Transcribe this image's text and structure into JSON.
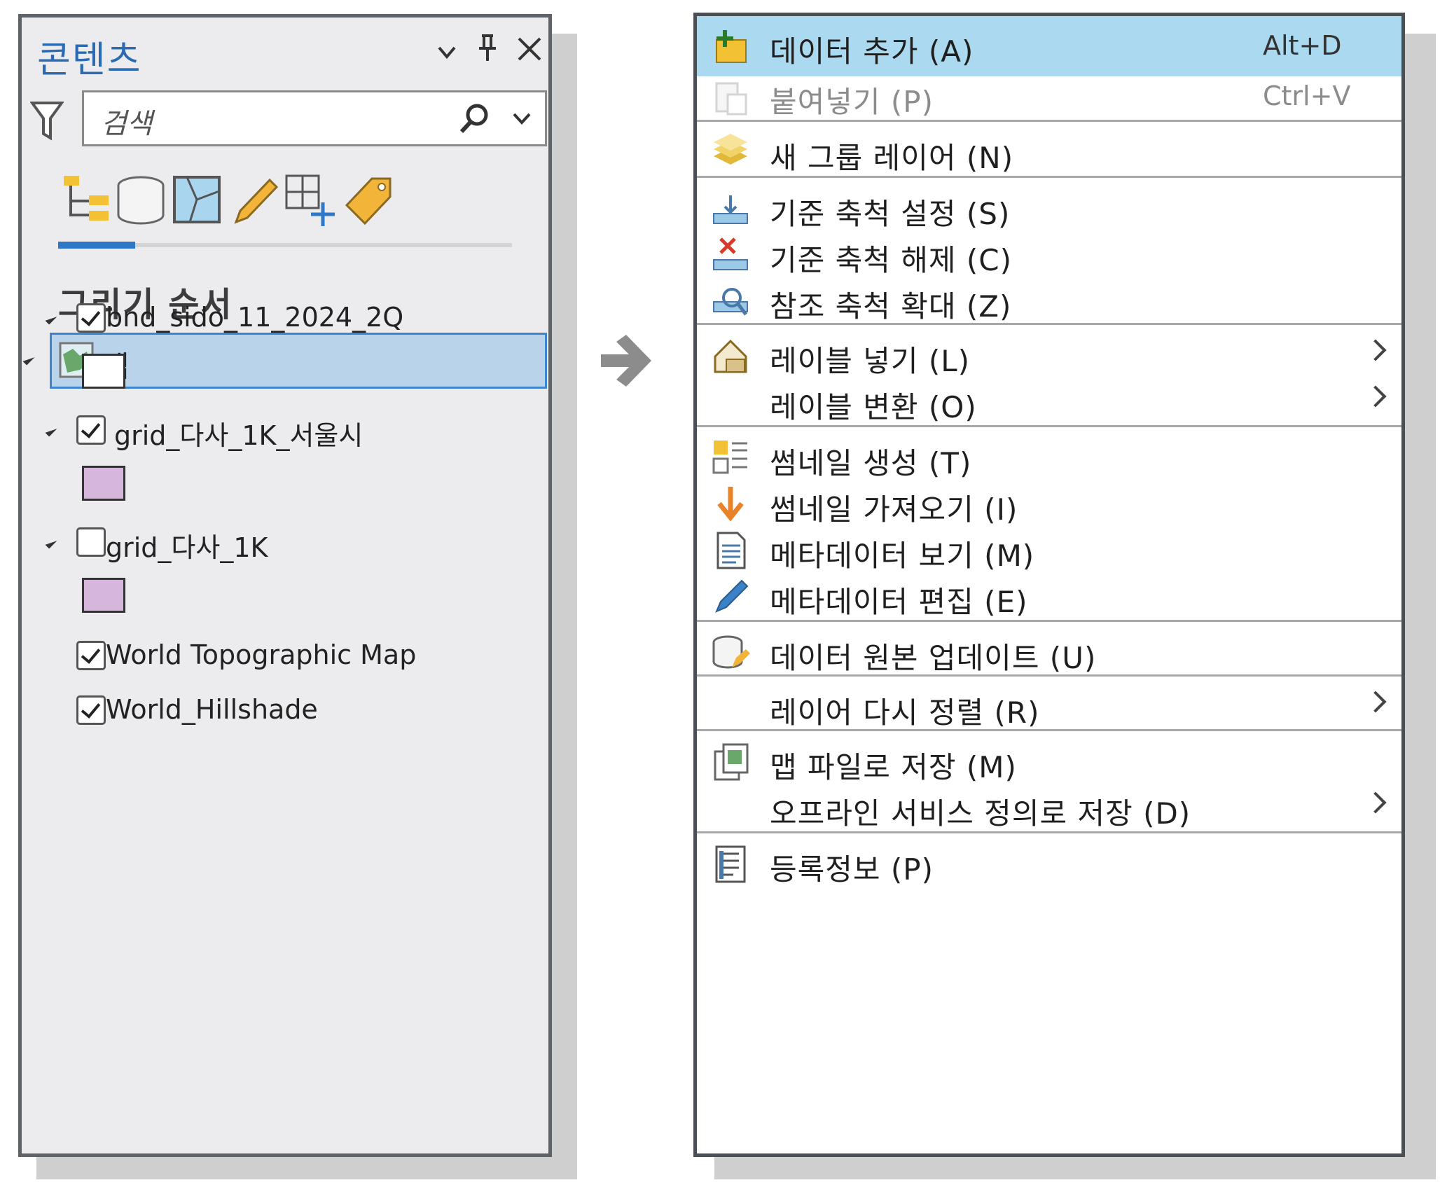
{
  "contents_pane": {
    "title": "콘텐츠",
    "search": {
      "placeholder": "검색"
    },
    "section_title": "그리기 순서",
    "map_node": "맵",
    "layers": [
      {
        "name": "bnd_sido_11_2024_2Q",
        "checked": true,
        "expandable": true,
        "symbol_color": "#ffffff"
      },
      {
        "name": "grid_다사_1K_서울시",
        "checked": true,
        "expandable": true,
        "symbol_color": "#d6b6dc"
      },
      {
        "name": "grid_다사_1K",
        "checked": false,
        "expandable": true,
        "symbol_color": "#d6b6dc"
      },
      {
        "name": "World Topographic Map",
        "checked": true,
        "expandable": false
      },
      {
        "name": "World_Hillshade",
        "checked": true,
        "expandable": false
      }
    ]
  },
  "context_menu": {
    "items": [
      {
        "label": "데이터 추가 (A)",
        "shortcut": "Alt+D",
        "icon": "add-data-icon",
        "highlighted": true
      },
      {
        "label": "붙여넣기 (P)",
        "shortcut": "Ctrl+V",
        "icon": "paste-icon",
        "disabled": true
      },
      {
        "label": "새 그룹 레이어 (N)",
        "icon": "group-layer-icon"
      },
      {
        "label": "기준 축척 설정 (S)",
        "icon": "set-reference-scale-icon"
      },
      {
        "label": "기준 축척 해제 (C)",
        "icon": "clear-reference-scale-icon"
      },
      {
        "label": "참조 축척 확대 (Z)",
        "icon": "zoom-to-reference-scale-icon"
      },
      {
        "label": "레이블 넣기 (L)",
        "icon": "label-icon",
        "submenu": true
      },
      {
        "label": "레이블 변환 (O)",
        "submenu": true
      },
      {
        "label": "썸네일 생성 (T)",
        "icon": "create-thumbnail-icon"
      },
      {
        "label": "썸네일 가져오기 (I)",
        "icon": "import-thumbnail-icon"
      },
      {
        "label": "메타데이터 보기 (M)",
        "icon": "view-metadata-icon"
      },
      {
        "label": "메타데이터 편집 (E)",
        "icon": "edit-metadata-icon"
      },
      {
        "label": "데이터 원본 업데이트 (U)",
        "icon": "update-data-source-icon"
      },
      {
        "label": "레이어 다시 정렬 (R)",
        "submenu": true
      },
      {
        "label": "맵 파일로 저장 (M)",
        "icon": "save-map-file-icon"
      },
      {
        "label": "오프라인 서비스 정의로 저장 (D)",
        "submenu": true
      },
      {
        "label": "등록정보 (P)",
        "icon": "properties-icon"
      }
    ]
  },
  "colors": {
    "accent": "#2e78c7",
    "highlight": "#aad9f0",
    "selection": "#b8d3ea"
  }
}
